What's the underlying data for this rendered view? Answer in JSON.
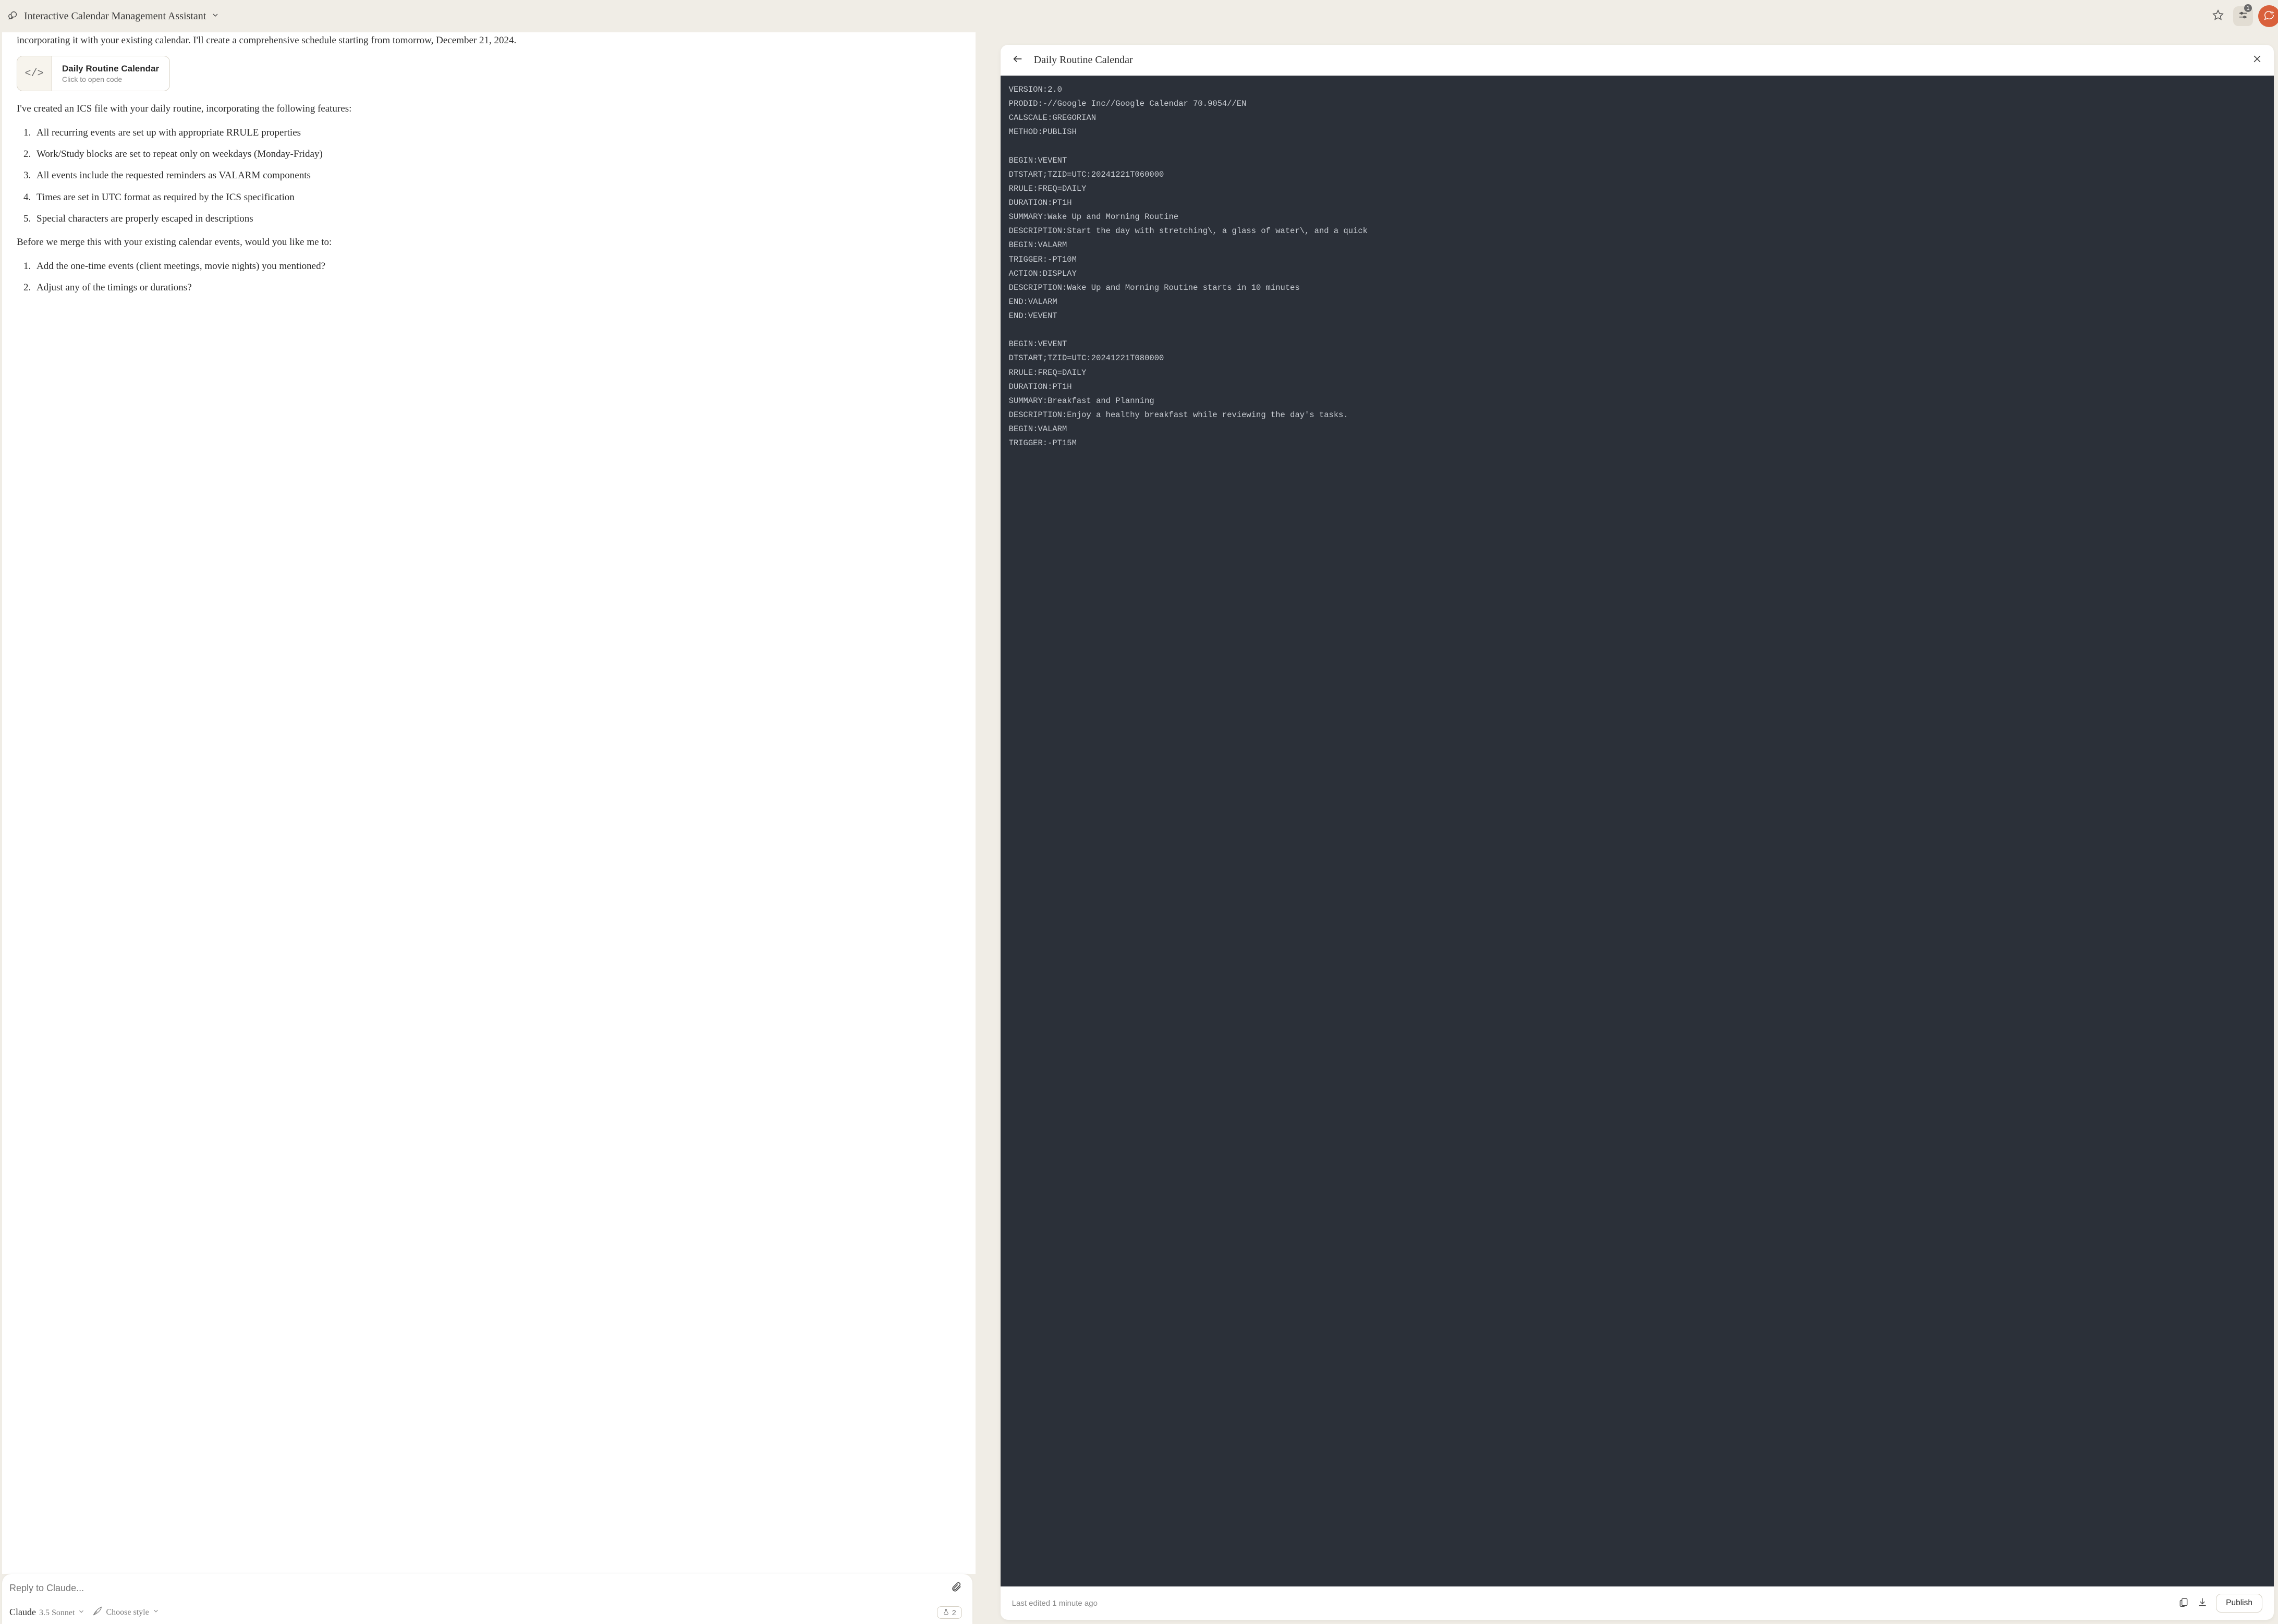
{
  "header": {
    "title": "Interactive Calendar Management Assistant",
    "settings_badge": "1"
  },
  "chat": {
    "intro_paragraph": "incorporating it with your existing calendar. I'll create a comprehensive schedule starting from tomorrow, December 21, 2024.",
    "code_card": {
      "title": "Daily Routine Calendar",
      "subtitle": "Click to open code"
    },
    "after_card_paragraph": "I've created an ICS file with your daily routine, incorporating the following features:",
    "features": [
      "All recurring events are set up with appropriate RRULE properties",
      "Work/Study blocks are set to repeat only on weekdays (Monday-Friday)",
      "All events include the requested reminders as VALARM components",
      "Times are set in UTC format as required by the ICS specification",
      "Special characters are properly escaped in descriptions"
    ],
    "before_merge_paragraph": "Before we merge this with your existing calendar events, would you like me to:",
    "questions": [
      "Add the one-time events (client meetings, movie nights) you mentioned?",
      "Adjust any of the timings or durations?"
    ]
  },
  "composer": {
    "placeholder": "Reply to Claude...",
    "model_name": "Claude",
    "model_version": "3.5 Sonnet",
    "style_label": "Choose style",
    "count": "2"
  },
  "panel": {
    "title": "Daily Routine Calendar",
    "code_lines": [
      "VERSION:2.0",
      "PRODID:-//Google Inc//Google Calendar 70.9054//EN",
      "CALSCALE:GREGORIAN",
      "METHOD:PUBLISH",
      "",
      "BEGIN:VEVENT",
      "DTSTART;TZID=UTC:20241221T060000",
      "RRULE:FREQ=DAILY",
      "DURATION:PT1H",
      "SUMMARY:Wake Up and Morning Routine",
      "DESCRIPTION:Start the day with stretching\\, a glass of water\\, and a quick",
      "BEGIN:VALARM",
      "TRIGGER:-PT10M",
      "ACTION:DISPLAY",
      "DESCRIPTION:Wake Up and Morning Routine starts in 10 minutes",
      "END:VALARM",
      "END:VEVENT",
      "",
      "BEGIN:VEVENT",
      "DTSTART;TZID=UTC:20241221T080000",
      "RRULE:FREQ=DAILY",
      "DURATION:PT1H",
      "SUMMARY:Breakfast and Planning",
      "DESCRIPTION:Enjoy a healthy breakfast while reviewing the day's tasks.",
      "BEGIN:VALARM",
      "TRIGGER:-PT15M"
    ],
    "last_edited": "Last edited 1 minute ago",
    "publish_label": "Publish"
  }
}
